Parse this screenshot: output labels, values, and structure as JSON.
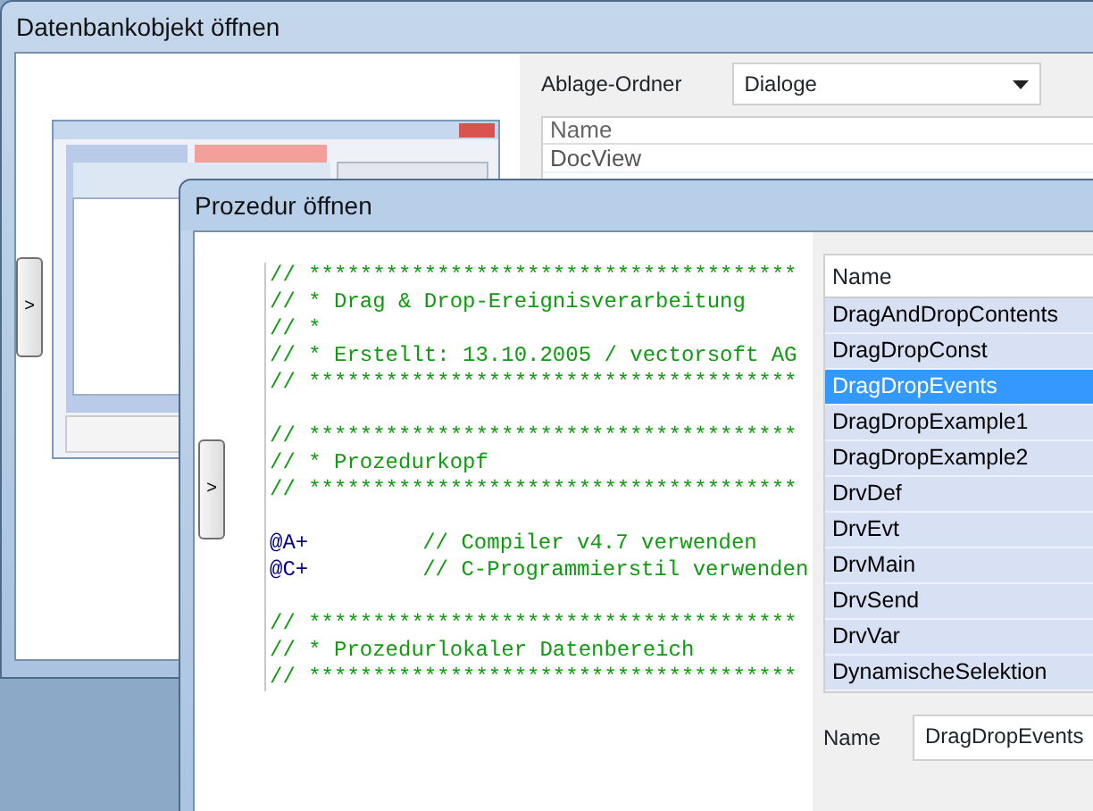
{
  "back_window": {
    "title": "Datenbankobjekt öffnen",
    "expand_button": ">",
    "folder_label": "Ablage-Ordner",
    "folder_value": "Dialoge",
    "list_header": "Name",
    "list_items": [
      "DocView"
    ]
  },
  "front_window": {
    "title": "Prozedur öffnen",
    "expand_button": ">",
    "code_blocks": [
      [
        {
          "kind": "comment",
          "text": "// **************************************"
        },
        {
          "kind": "comment",
          "text": "// * Drag & Drop-Ereignisverarbeitung"
        },
        {
          "kind": "comment",
          "text": "// *"
        },
        {
          "kind": "comment",
          "text": "// * Erstellt: 13.10.2005 / vectorsoft AG"
        },
        {
          "kind": "comment",
          "text": "// **************************************"
        }
      ],
      [
        {
          "kind": "comment",
          "text": "// **************************************"
        },
        {
          "kind": "comment",
          "text": "// * Prozedurkopf"
        },
        {
          "kind": "comment",
          "text": "// **************************************"
        }
      ],
      [
        {
          "kind": "directive",
          "directive": "@A+",
          "comment": "// Compiler v4.7 verwenden"
        },
        {
          "kind": "directive",
          "directive": "@C+",
          "comment": "// C-Programmierstil verwenden"
        }
      ],
      [
        {
          "kind": "comment",
          "text": "// **************************************"
        },
        {
          "kind": "comment",
          "text": "// * Prozedurlokaler Datenbereich"
        },
        {
          "kind": "comment",
          "text": "// **************************************"
        }
      ]
    ],
    "list_header": "Name",
    "list_items": [
      {
        "label": "DragAndDropContents",
        "selected": false
      },
      {
        "label": "DragDropConst",
        "selected": false
      },
      {
        "label": "DragDropEvents",
        "selected": true
      },
      {
        "label": "DragDropExample1",
        "selected": false
      },
      {
        "label": "DragDropExample2",
        "selected": false
      },
      {
        "label": "DrvDef",
        "selected": false
      },
      {
        "label": "DrvEvt",
        "selected": false
      },
      {
        "label": "DrvMain",
        "selected": false
      },
      {
        "label": "DrvSend",
        "selected": false
      },
      {
        "label": "DrvVar",
        "selected": false
      },
      {
        "label": "DynamischeSelektion",
        "selected": false
      }
    ],
    "name_label": "Name",
    "name_value": "DragDropEvents"
  }
}
